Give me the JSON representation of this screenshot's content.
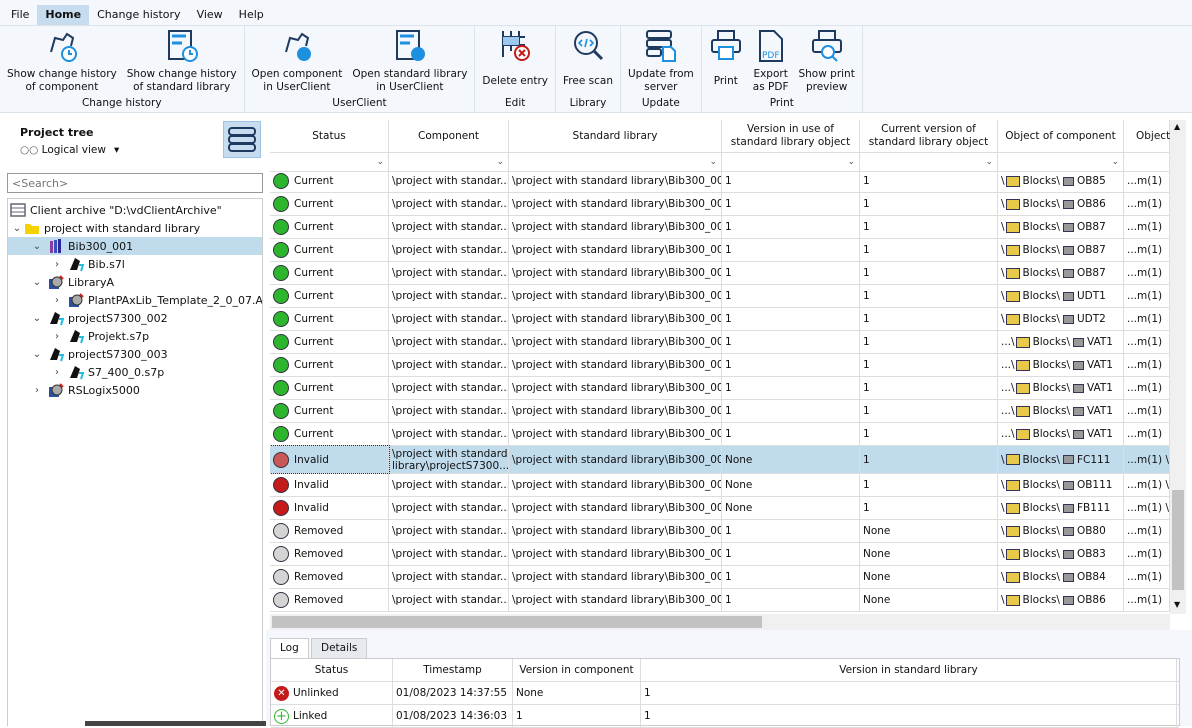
{
  "menu": [
    "File",
    "Home",
    "Change history",
    "View",
    "Help"
  ],
  "ribbon": {
    "groups": [
      {
        "label": "Change history",
        "buttons": [
          {
            "label": "Show change history\nof component",
            "icon": "component-history-icon"
          },
          {
            "label": "Show change history\nof standard library",
            "icon": "library-history-icon"
          }
        ]
      },
      {
        "label": "UserClient",
        "buttons": [
          {
            "label": "Open component\nin UserClient",
            "icon": "component-userclient-icon"
          },
          {
            "label": "Open standard library\nin UserClient",
            "icon": "library-userclient-icon"
          }
        ]
      },
      {
        "label": "Edit",
        "buttons": [
          {
            "label": "Delete entry",
            "icon": "delete-entry-icon"
          }
        ]
      },
      {
        "label": "Library",
        "buttons": [
          {
            "label": "Free scan",
            "icon": "free-scan-icon"
          }
        ]
      },
      {
        "label": "Update",
        "buttons": [
          {
            "label": "Update from\nserver",
            "icon": "server-update-icon"
          }
        ]
      },
      {
        "label": "Print",
        "buttons": [
          {
            "label": "Print",
            "icon": "printer-icon"
          },
          {
            "label": "Export\nas PDF",
            "icon": "pdf-icon"
          },
          {
            "label": "Show print\npreview",
            "icon": "print-preview-icon"
          }
        ]
      }
    ]
  },
  "left": {
    "title": "Project tree",
    "view": "Logical view",
    "search_placeholder": "<Search>",
    "tree": [
      {
        "label": "Client archive \"D:\\vdClientArchive\"",
        "level": 0,
        "chev": "",
        "icon": "archive"
      },
      {
        "label": "project with standard library",
        "level": 0,
        "chev": "v",
        "icon": "folder"
      },
      {
        "label": "Bib300_001",
        "level": 1,
        "chev": "v",
        "icon": "library",
        "selected": true
      },
      {
        "label": "Bib.s7l",
        "level": 2,
        "chev": ">",
        "icon": "s7"
      },
      {
        "label": "LibraryA",
        "level": 1,
        "chev": "v",
        "icon": "rs"
      },
      {
        "label": "PlantPAxLib_Template_2_0_07.ACD",
        "level": 2,
        "chev": ">",
        "icon": "rs"
      },
      {
        "label": "projectS7300_002",
        "level": 1,
        "chev": "v",
        "icon": "s7"
      },
      {
        "label": "Projekt.s7p",
        "level": 2,
        "chev": ">",
        "icon": "s7"
      },
      {
        "label": "projectS7300_003",
        "level": 1,
        "chev": "v",
        "icon": "s7"
      },
      {
        "label": "S7_400_0.s7p",
        "level": 2,
        "chev": ">",
        "icon": "s7"
      },
      {
        "label": "RSLogix5000",
        "level": 1,
        "chev": ">",
        "icon": "rs"
      }
    ]
  },
  "colors": {
    "current": "#2db52d",
    "invalid": "#c41a1a",
    "invalid_selected": "#c85858",
    "removed": "#d4d4d4",
    "selection": "#c0dbec"
  },
  "grid": {
    "columns": [
      "Status",
      "Component",
      "Standard library",
      "Version in use of\nstandard library object",
      "Current version of\nstandard library object",
      "Object of component",
      "Object"
    ],
    "rows": [
      [
        "current",
        "Current",
        "\\project with standar...",
        "\\project with standard library\\Bib300_001",
        "1",
        "1",
        "",
        "OB85",
        "...m(1)"
      ],
      [
        "current",
        "Current",
        "\\project with standar...",
        "\\project with standard library\\Bib300_001",
        "1",
        "1",
        "",
        "OB86",
        "...m(1)"
      ],
      [
        "current",
        "Current",
        "\\project with standar...",
        "\\project with standard library\\Bib300_001",
        "1",
        "1",
        "",
        "OB87",
        "...m(1)"
      ],
      [
        "current",
        "Current",
        "\\project with standar...",
        "\\project with standard library\\Bib300_001",
        "1",
        "1",
        "",
        "OB87",
        "...m(1)"
      ],
      [
        "current",
        "Current",
        "\\project with standar...",
        "\\project with standard library\\Bib300_001",
        "1",
        "1",
        "",
        "OB87",
        "...m(1)"
      ],
      [
        "current",
        "Current",
        "\\project with standar...",
        "\\project with standard library\\Bib300_001",
        "1",
        "1",
        "",
        "UDT1",
        "...m(1)"
      ],
      [
        "current",
        "Current",
        "\\project with standar...",
        "\\project with standard library\\Bib300_001",
        "1",
        "1",
        "",
        "UDT2",
        "...m(1)"
      ],
      [
        "current",
        "Current",
        "\\project with standar...",
        "\\project with standard library\\Bib300_001",
        "1",
        "1",
        "... ",
        "VAT1",
        "...m(1)"
      ],
      [
        "current",
        "Current",
        "\\project with standar...",
        "\\project with standard library\\Bib300_001",
        "1",
        "1",
        "... ",
        "VAT1",
        "...m(1)"
      ],
      [
        "current",
        "Current",
        "\\project with standar...",
        "\\project with standard library\\Bib300_001",
        "1",
        "1",
        "... ",
        "VAT1",
        "...m(1)"
      ],
      [
        "current",
        "Current",
        "\\project with standar...",
        "\\project with standard library\\Bib300_001",
        "1",
        "1",
        "... ",
        "VAT1",
        "...m(1)"
      ],
      [
        "current",
        "Current",
        "\\project with standar...",
        "\\project with standard library\\Bib300_001",
        "1",
        "1",
        "... ",
        "VAT1",
        "...m(1)"
      ],
      [
        "invalid_selected",
        "Invalid",
        "\\project with standard\nlibrary\\projectS7300...",
        "\\project with standard library\\Bib300_001",
        "None",
        "1",
        "",
        "FC111",
        "...m(1) \\"
      ],
      [
        "invalid",
        "Invalid",
        "\\project with standar...",
        "\\project with standard library\\Bib300_001",
        "None",
        "1",
        "",
        "OB111",
        "...m(1) \\"
      ],
      [
        "invalid",
        "Invalid",
        "\\project with standar...",
        "\\project with standard library\\Bib300_001",
        "None",
        "1",
        "",
        "FB111",
        "...m(1) \\"
      ],
      [
        "removed",
        "Removed",
        "\\project with standar...",
        "\\project with standard library\\Bib300_001",
        "1",
        "None",
        "",
        "OB80",
        "...m(1)"
      ],
      [
        "removed",
        "Removed",
        "\\project with standar...",
        "\\project with standard library\\Bib300_001",
        "1",
        "None",
        "",
        "OB83",
        "...m(1)"
      ],
      [
        "removed",
        "Removed",
        "\\project with standar...",
        "\\project with standard library\\Bib300_001",
        "1",
        "None",
        "",
        "OB84",
        "...m(1)"
      ],
      [
        "removed",
        "Removed",
        "\\project with standar...",
        "\\project with standard library\\Bib300_001",
        "1",
        "None",
        "",
        "OB86",
        "...m(1)"
      ]
    ],
    "blocks_label": "Blocks"
  },
  "bottom": {
    "tabs": [
      "Log",
      "Details"
    ],
    "columns": [
      "Status",
      "Timestamp",
      "Version in component",
      "Version in standard library"
    ],
    "rows": [
      {
        "icon": "unlinked",
        "status": "Unlinked",
        "timestamp": "01/08/2023 14:37:55",
        "vcomp": "None",
        "vlib": "1"
      },
      {
        "icon": "linked",
        "status": "Linked",
        "timestamp": "01/08/2023 14:36:03",
        "vcomp": "1",
        "vlib": "1"
      }
    ]
  }
}
